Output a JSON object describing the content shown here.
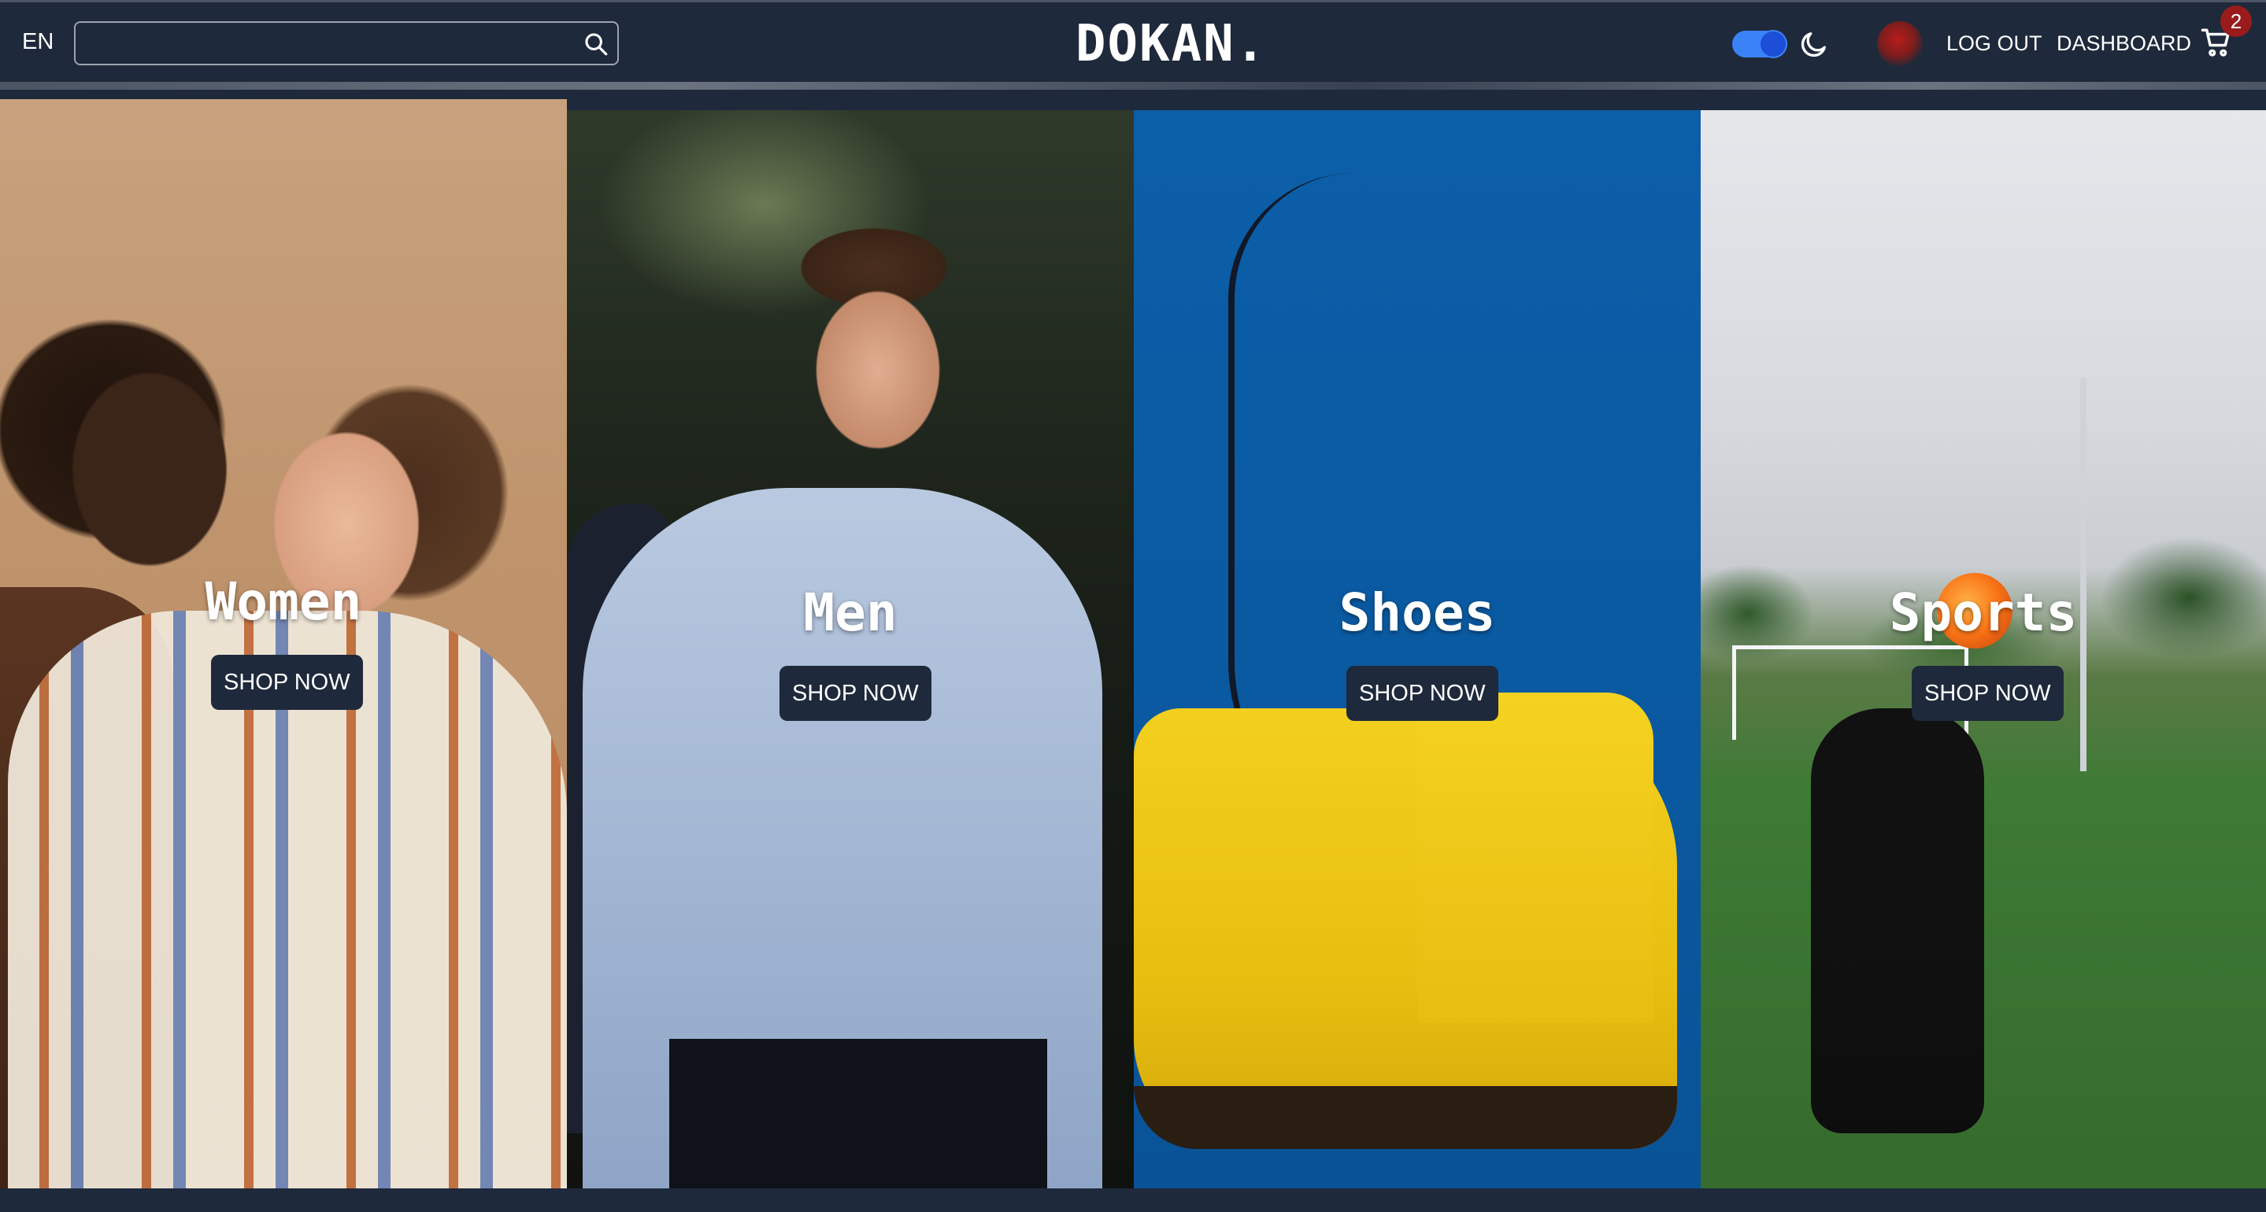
{
  "header": {
    "language": "EN",
    "search": {
      "value": "",
      "placeholder": ""
    },
    "logo": "DOKAN.",
    "theme_toggle": {
      "on": true
    },
    "logout_label": "LOG OUT",
    "dashboard_label": "DASHBOARD",
    "cart_count": "2",
    "icons": [
      "search-icon",
      "moon-icon",
      "cart-icon"
    ]
  },
  "categories": [
    {
      "title": "Women",
      "button": "SHOP NOW"
    },
    {
      "title": "Men",
      "button": "SHOP NOW"
    },
    {
      "title": "Shoes",
      "button": "SHOP NOW"
    },
    {
      "title": "Sports",
      "button": "SHOP NOW"
    }
  ],
  "colors": {
    "header_bg": "#1e293b",
    "toggle_accent": "#3b82f6",
    "badge": "#991b1b"
  }
}
